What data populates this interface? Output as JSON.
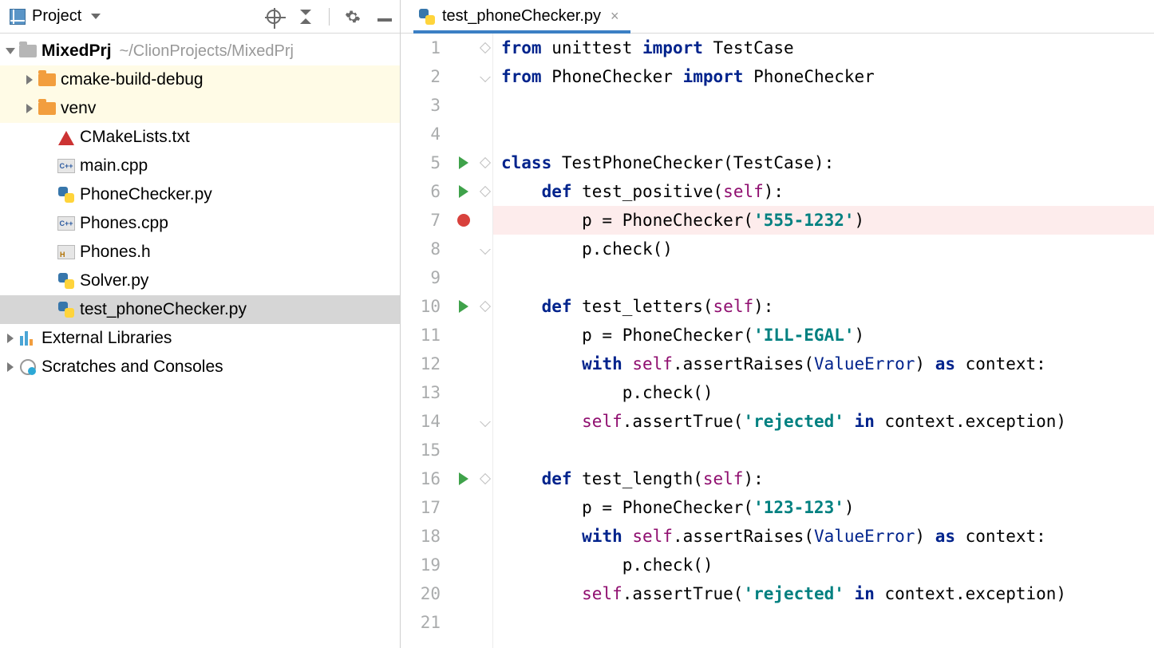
{
  "sidebar": {
    "title": "Project",
    "project": {
      "name": "MixedPrj",
      "path": "~/ClionProjects/MixedPrj"
    },
    "items": [
      {
        "label": "cmake-build-debug"
      },
      {
        "label": "venv"
      },
      {
        "label": "CMakeLists.txt"
      },
      {
        "label": "main.cpp"
      },
      {
        "label": "PhoneChecker.py"
      },
      {
        "label": "Phones.cpp"
      },
      {
        "label": "Phones.h"
      },
      {
        "label": "Solver.py"
      },
      {
        "label": "test_phoneChecker.py"
      }
    ],
    "external": "External Libraries",
    "scratches": "Scratches and Consoles"
  },
  "editor": {
    "tab": {
      "filename": "test_phoneChecker.py"
    },
    "lines": [
      "1",
      "2",
      "3",
      "4",
      "5",
      "6",
      "7",
      "8",
      "9",
      "10",
      "11",
      "12",
      "13",
      "14",
      "15",
      "16",
      "17",
      "18",
      "19",
      "20",
      "21"
    ],
    "code": {
      "l1": {
        "a": "from ",
        "b": "unittest ",
        "c": "import ",
        "d": "TestCase"
      },
      "l2": {
        "a": "from ",
        "b": "PhoneChecker ",
        "c": "import ",
        "d": "PhoneChecker"
      },
      "l5": {
        "a": "class ",
        "b": "TestPhoneChecker(TestCase):"
      },
      "l6": {
        "a": "    ",
        "b": "def ",
        "c": "test_positive(",
        "d": "self",
        "e": "):"
      },
      "l7": {
        "a": "        p = PhoneChecker(",
        "b": "'555-1232'",
        "c": ")"
      },
      "l8": {
        "a": "        p.check()"
      },
      "l10": {
        "a": "    ",
        "b": "def ",
        "c": "test_letters(",
        "d": "self",
        "e": "):"
      },
      "l11": {
        "a": "        p = PhoneChecker(",
        "b": "'ILL-EGAL'",
        "c": ")"
      },
      "l12": {
        "a": "        ",
        "b": "with ",
        "c": "self",
        "d": ".assertRaises(",
        "e": "ValueError",
        "f": ") ",
        "g": "as ",
        "h": "context:"
      },
      "l13": {
        "a": "            p.check()"
      },
      "l14": {
        "a": "        ",
        "b": "self",
        "c": ".assertTrue(",
        "d": "'rejected'",
        "e": " ",
        "f": "in ",
        "g": "context.exception)"
      },
      "l16": {
        "a": "    ",
        "b": "def ",
        "c": "test_length(",
        "d": "self",
        "e": "):"
      },
      "l17": {
        "a": "        p = PhoneChecker(",
        "b": "'123-123'",
        "c": ")"
      },
      "l18": {
        "a": "        ",
        "b": "with ",
        "c": "self",
        "d": ".assertRaises(",
        "e": "ValueError",
        "f": ") ",
        "g": "as ",
        "h": "context:"
      },
      "l19": {
        "a": "            p.check()"
      },
      "l20": {
        "a": "        ",
        "b": "self",
        "c": ".assertTrue(",
        "d": "'rejected'",
        "e": " ",
        "f": "in ",
        "g": "context.exception)"
      }
    }
  }
}
